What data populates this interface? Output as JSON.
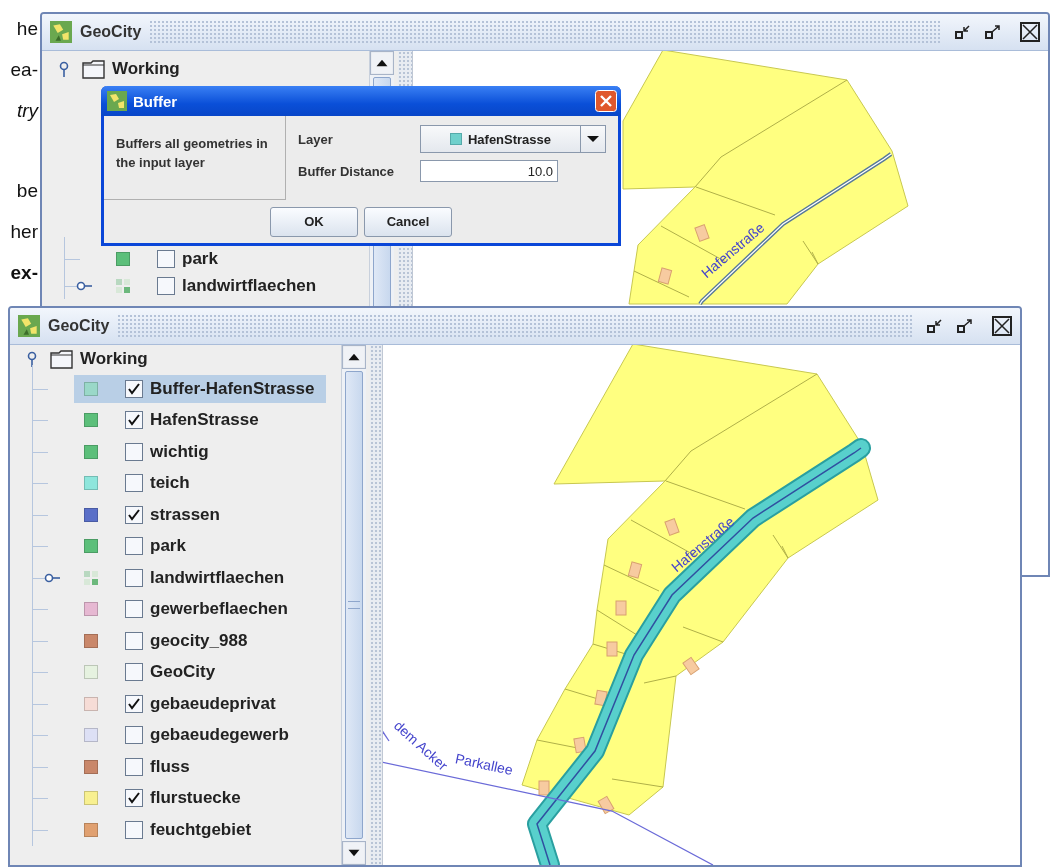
{
  "document_fragments": [
    {
      "text": "he",
      "kind": "plain"
    },
    {
      "text": "ea-",
      "kind": "plain"
    },
    {
      "text": "try",
      "kind": "italic"
    },
    {
      "text": "be",
      "kind": "plain"
    },
    {
      "text": "her",
      "kind": "plain"
    },
    {
      "text": "ex-",
      "kind": "bold"
    }
  ],
  "windows": [
    {
      "title": "GeoCity",
      "tree": {
        "root": "Working",
        "children": [
          {
            "label": "park",
            "kind": "layer",
            "color": "#5cbf7a",
            "checked": false,
            "selected": false
          },
          {
            "label": "landwirtflaechen",
            "kind": "group",
            "checked": false,
            "selected": false
          }
        ]
      },
      "map": {
        "buffer_visible": false,
        "labels": [
          {
            "text": "Hafenstraße",
            "kind": "main"
          }
        ]
      },
      "dialog": {
        "title": "Buffer",
        "description": "Buffers all geometries in the input layer",
        "fields": [
          {
            "label": "Layer",
            "kind": "select",
            "value": "HafenStrasse",
            "color": "#6fd0cc"
          },
          {
            "label": "Buffer Distance",
            "kind": "number",
            "value": "10.0"
          }
        ],
        "buttons": [
          "OK",
          "Cancel"
        ]
      }
    },
    {
      "title": "GeoCity",
      "tree": {
        "root": "Working",
        "children": [
          {
            "label": "Buffer-HafenStrasse",
            "kind": "layer",
            "color": "#9ad8c8",
            "checked": true,
            "selected": true
          },
          {
            "label": "HafenStrasse",
            "kind": "layer",
            "color": "#5cbf7a",
            "checked": true,
            "selected": false
          },
          {
            "label": "wichtig",
            "kind": "layer",
            "color": "#5cbf7a",
            "checked": false,
            "selected": false
          },
          {
            "label": "teich",
            "kind": "layer",
            "color": "#8ee6dc",
            "checked": false,
            "selected": false
          },
          {
            "label": "strassen",
            "kind": "layer",
            "color": "#5a6fc8",
            "checked": true,
            "selected": false
          },
          {
            "label": "park",
            "kind": "layer",
            "color": "#5cbf7a",
            "checked": false,
            "selected": false
          },
          {
            "label": "landwirtflaechen",
            "kind": "group",
            "checked": false,
            "selected": false
          },
          {
            "label": "gewerbeflaechen",
            "kind": "layer",
            "color": "#e6b8d2",
            "checked": false,
            "selected": false
          },
          {
            "label": "geocity_988",
            "kind": "layer",
            "color": "#c9876a",
            "checked": false,
            "selected": false
          },
          {
            "label": "GeoCity",
            "kind": "layer",
            "color": "#e6f2e0",
            "checked": false,
            "selected": false
          },
          {
            "label": "gebaeudeprivat",
            "kind": "layer",
            "color": "#f6dcd6",
            "checked": true,
            "selected": false
          },
          {
            "label": "gebaeudegewerb",
            "kind": "layer",
            "color": "#dde0f5",
            "checked": false,
            "selected": false
          },
          {
            "label": "fluss",
            "kind": "layer",
            "color": "#c9876a",
            "checked": false,
            "selected": false
          },
          {
            "label": "flurstuecke",
            "kind": "layer",
            "color": "#f8f090",
            "checked": true,
            "selected": false
          },
          {
            "label": "feuchtgebiet",
            "kind": "layer",
            "color": "#e0a070",
            "checked": false,
            "selected": false
          }
        ]
      },
      "map": {
        "buffer_visible": true,
        "labels": [
          {
            "text": "Hafenstraße",
            "kind": "main"
          },
          {
            "text": "Parkallee",
            "kind": "side"
          },
          {
            "text": "dem Acker",
            "kind": "path"
          }
        ]
      }
    }
  ]
}
